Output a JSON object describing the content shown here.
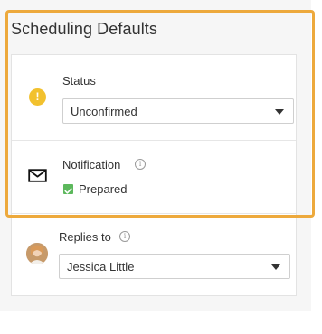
{
  "panel": {
    "title": "Scheduling Defaults"
  },
  "status": {
    "icon": "exclamation-icon",
    "icon_color": "#f2c12e",
    "label": "Status",
    "selected": "Unconfirmed"
  },
  "notification": {
    "icon": "envelope-icon",
    "label": "Notification",
    "info_icon": "info-icon",
    "checkbox_label": "Prepared",
    "checked": true,
    "check_color": "#5cb85c"
  },
  "replies": {
    "label": "Replies to",
    "info_icon": "info-icon",
    "avatar_icon": "user-avatar",
    "selected": "Jessica Little"
  },
  "highlight": {
    "color": "#eda93c"
  }
}
